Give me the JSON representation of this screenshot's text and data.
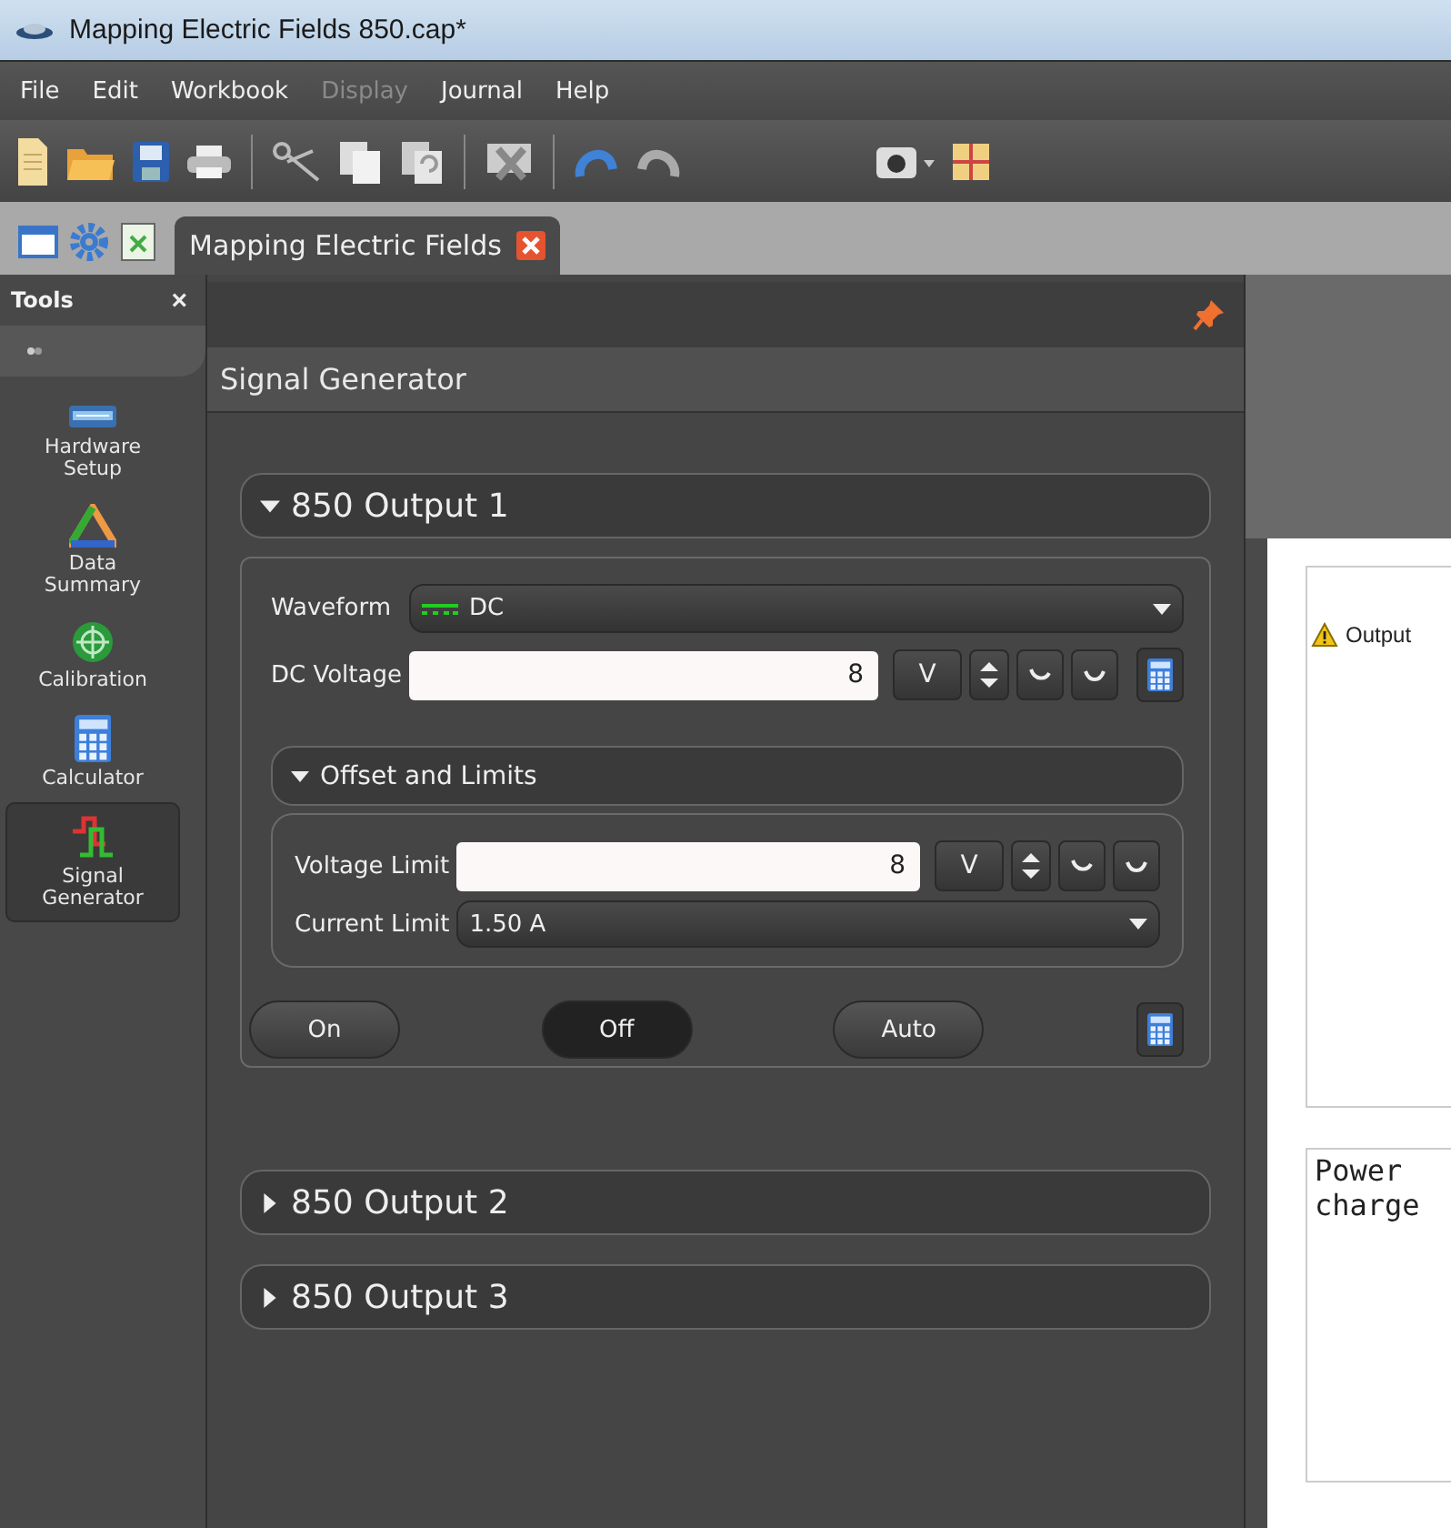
{
  "window": {
    "title": "Mapping Electric Fields 850.cap*"
  },
  "menu": [
    {
      "label": "File",
      "disabled": false
    },
    {
      "label": "Edit",
      "disabled": false
    },
    {
      "label": "Workbook",
      "disabled": false
    },
    {
      "label": "Display",
      "disabled": true
    },
    {
      "label": "Journal",
      "disabled": false
    },
    {
      "label": "Help",
      "disabled": false
    }
  ],
  "tabs": [
    {
      "label": "Mapping Electric Fields",
      "selected": true
    }
  ],
  "tools": {
    "title": "Tools",
    "close": "×",
    "items": [
      {
        "kind": "hardware",
        "label": "Hardware Setup",
        "selected": false
      },
      {
        "kind": "summary",
        "label": "Data Summary",
        "selected": false
      },
      {
        "kind": "calibration",
        "label": "Calibration",
        "selected": false
      },
      {
        "kind": "calculator",
        "label": "Calculator",
        "selected": false
      },
      {
        "kind": "signal",
        "label": "Signal Generator",
        "selected": true
      }
    ]
  },
  "panel": {
    "title": "Signal Generator",
    "outputs": [
      {
        "label": "850 Output 1",
        "expanded": true,
        "waveform_label": "Waveform",
        "waveform": "DC",
        "voltage_label": "DC Voltage",
        "voltage": "8",
        "unit": "V",
        "offset": {
          "label": "Offset and Limits",
          "expanded": true,
          "voltage_limit_label": "Voltage Limit",
          "voltage_limit": "8",
          "unit": "V",
          "current_limit_label": "Current Limit",
          "current_limit": "1.50 A"
        },
        "modes": [
          {
            "label": "On",
            "selected": false
          },
          {
            "label": "Off",
            "selected": true
          },
          {
            "label": "Auto",
            "selected": false
          }
        ]
      },
      {
        "label": "850 Output 2",
        "expanded": false
      },
      {
        "label": "850 Output 3",
        "expanded": false
      }
    ]
  },
  "page": {
    "warning": "Output",
    "note_lines": [
      "Power",
      "charge"
    ]
  }
}
